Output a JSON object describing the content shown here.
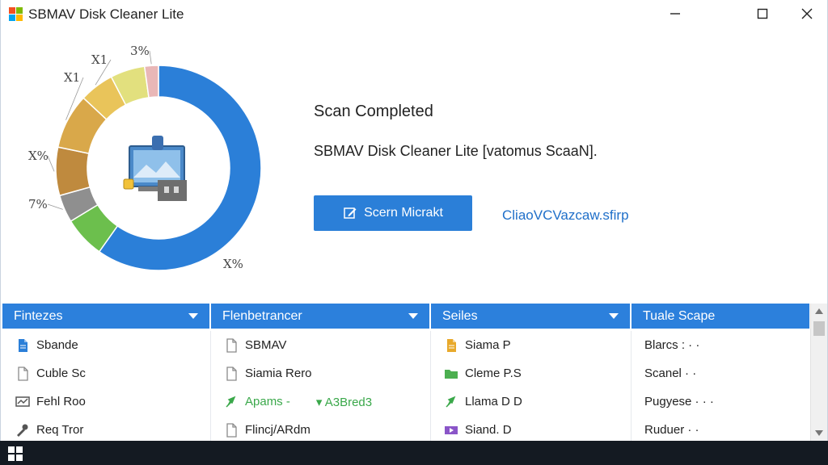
{
  "window": {
    "title": "SBMAV Disk Cleaner Lite",
    "logo_colors": [
      "#f25022",
      "#7fba00",
      "#00a4ef",
      "#ffb900"
    ],
    "controls": {
      "minimize": "minimize-icon",
      "maximize": "maximize-icon",
      "close": "close-icon"
    }
  },
  "chart_data": {
    "type": "pie",
    "style": "donut",
    "center_icon": "disk-cleanup-icon",
    "slices": [
      {
        "label": "X%",
        "value": 55,
        "color": "#2b7fd8"
      },
      {
        "label": "",
        "value": 6,
        "color": "#6cbf4d"
      },
      {
        "label": "7%",
        "value": 4,
        "color": "#8f8f8f"
      },
      {
        "label": "X%",
        "value": 7,
        "color": "#bf8a3e"
      },
      {
        "label": "X1",
        "value": 8,
        "color": "#d9a84a"
      },
      {
        "label": "X1",
        "value": 5,
        "color": "#e9c45a"
      },
      {
        "label": "",
        "value": 5,
        "color": "#e2e07e"
      },
      {
        "label": "3%",
        "value": 2,
        "color": "#e9b7b7"
      }
    ]
  },
  "status": {
    "title": "Scan Completed",
    "subtitle": "SBMAV  Disk Cleaner Lite [vatomus ScaaN].",
    "button_label": "Scern Micrakt",
    "link_text": "CliaoVCVazcaw.sfirp"
  },
  "table": {
    "headers": [
      "Fintezes",
      "Flenbetrancer",
      "Seiles",
      "Tuale Scape"
    ],
    "rows": [
      [
        {
          "text": "Sbande",
          "icon": "document-icon",
          "color": "#2b7fd8"
        },
        {
          "text": "SBMAV",
          "icon": "file-icon",
          "color": "#8a8a8a"
        },
        {
          "text": "Siama P",
          "icon": "document-icon",
          "color": "#e8a92b"
        },
        {
          "text": "Blarcs : · ·",
          "icon": "",
          "color": "#222"
        }
      ],
      [
        {
          "text": "Cuble Sc",
          "icon": "file-icon",
          "color": "#8a8a8a"
        },
        {
          "text": "Siamia Rero",
          "icon": "file-icon",
          "color": "#8a8a8a"
        },
        {
          "text": "Cleme P.S",
          "icon": "folder-icon",
          "color": "#4caf50"
        },
        {
          "text": "Scanel · ·",
          "icon": "",
          "color": "#222"
        }
      ],
      [
        {
          "text": "Fehl Roo",
          "icon": "monitor-chart-icon",
          "color": "#555"
        },
        {
          "text": "Apams -",
          "extra": "▾  A3Bred3",
          "icon": "pin-icon",
          "color": "#3aa84a"
        },
        {
          "text": "Llama D D",
          "icon": "pin-icon",
          "color": "#3aa84a"
        },
        {
          "text": "Pugyese · · ·",
          "icon": "",
          "color": "#222"
        }
      ],
      [
        {
          "text": "Req Tror",
          "icon": "tool-icon",
          "color": "#555"
        },
        {
          "text": "Flincj/ARdm",
          "icon": "file-icon",
          "color": "#8a8a8a"
        },
        {
          "text": "Siand. D",
          "icon": "video-icon",
          "color": "#8a55c8"
        },
        {
          "text": "Ruduer · ·",
          "icon": "",
          "color": "#222"
        }
      ]
    ]
  },
  "taskbar": {
    "start_icon": "windows-start-icon"
  }
}
